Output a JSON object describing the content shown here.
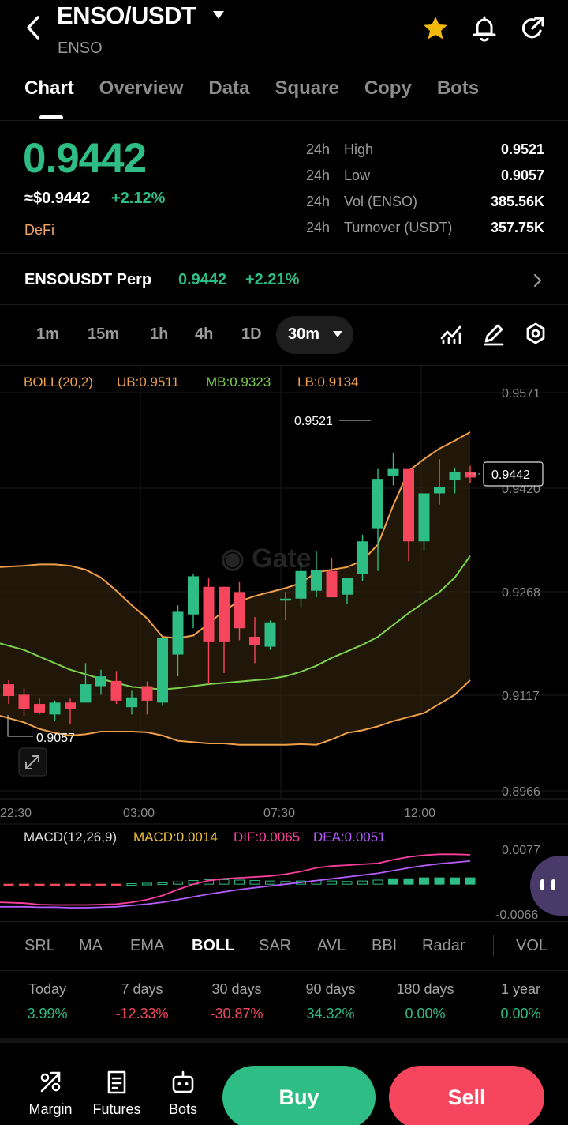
{
  "header": {
    "pair": "ENSO/USDT",
    "subtitle": "ENSO"
  },
  "tabs": [
    "Chart",
    "Overview",
    "Data",
    "Square",
    "Copy",
    "Bots"
  ],
  "price": {
    "last": "0.9442",
    "usd": "≈$0.9442",
    "change": "+2.12%",
    "tag": "DeFi"
  },
  "stats": [
    {
      "period": "24h",
      "label": "High",
      "value": "0.9521"
    },
    {
      "period": "24h",
      "label": "Low",
      "value": "0.9057"
    },
    {
      "period": "24h",
      "label": "Vol (ENSO)",
      "value": "385.56K"
    },
    {
      "period": "24h",
      "label": "Turnover (USDT)",
      "value": "357.75K"
    }
  ],
  "perp": {
    "name": "ENSOUSDT Perp",
    "price": "0.9442",
    "change": "+2.21%"
  },
  "intervals": [
    "1m",
    "15m",
    "1h",
    "4h",
    "1D"
  ],
  "active_interval": "30m",
  "boll": {
    "name": "BOLL(20,2)",
    "ub": "UB:0.9511",
    "mb": "MB:0.9323",
    "lb": "LB:0.9134"
  },
  "chart": {
    "y_ticks": [
      "0.9571",
      "0.9420",
      "0.9268",
      "0.9117",
      "0.8966"
    ],
    "x_ticks": [
      "22:30",
      "03:00",
      "07:30",
      "12:00"
    ],
    "high_label": "0.9521",
    "low_label": "0.9057",
    "current_label": "0.9442",
    "colors": {
      "up": "#2ebd85",
      "down": "#f6465d",
      "ub": "#f0a048",
      "mb": "#7cd14a",
      "lb": "#f0a048"
    }
  },
  "macd": {
    "name": "MACD(12,26,9)",
    "macd": "MACD:0.0014",
    "dif": "DIF:0.0065",
    "dea": "DEA:0.0051",
    "y_ticks": [
      "0.0077",
      "-0.0066"
    ]
  },
  "indicator_tabs": [
    "SRL",
    "MA",
    "EMA",
    "BOLL",
    "SAR",
    "AVL",
    "BBI",
    "Radar",
    "VOL"
  ],
  "active_indicator": "BOLL",
  "performance": [
    {
      "label": "Today",
      "value": "3.99%",
      "dir": "up"
    },
    {
      "label": "7 days",
      "value": "-12.33%",
      "dir": "down"
    },
    {
      "label": "30 days",
      "value": "-30.87%",
      "dir": "down"
    },
    {
      "label": "90 days",
      "value": "34.32%",
      "dir": "up"
    },
    {
      "label": "180 days",
      "value": "0.00%",
      "dir": "up"
    },
    {
      "label": "1 year",
      "value": "0.00%",
      "dir": "up"
    }
  ],
  "bottom": {
    "margin": "Margin",
    "futures": "Futures",
    "bots": "Bots",
    "buy": "Buy",
    "sell": "Sell"
  }
}
